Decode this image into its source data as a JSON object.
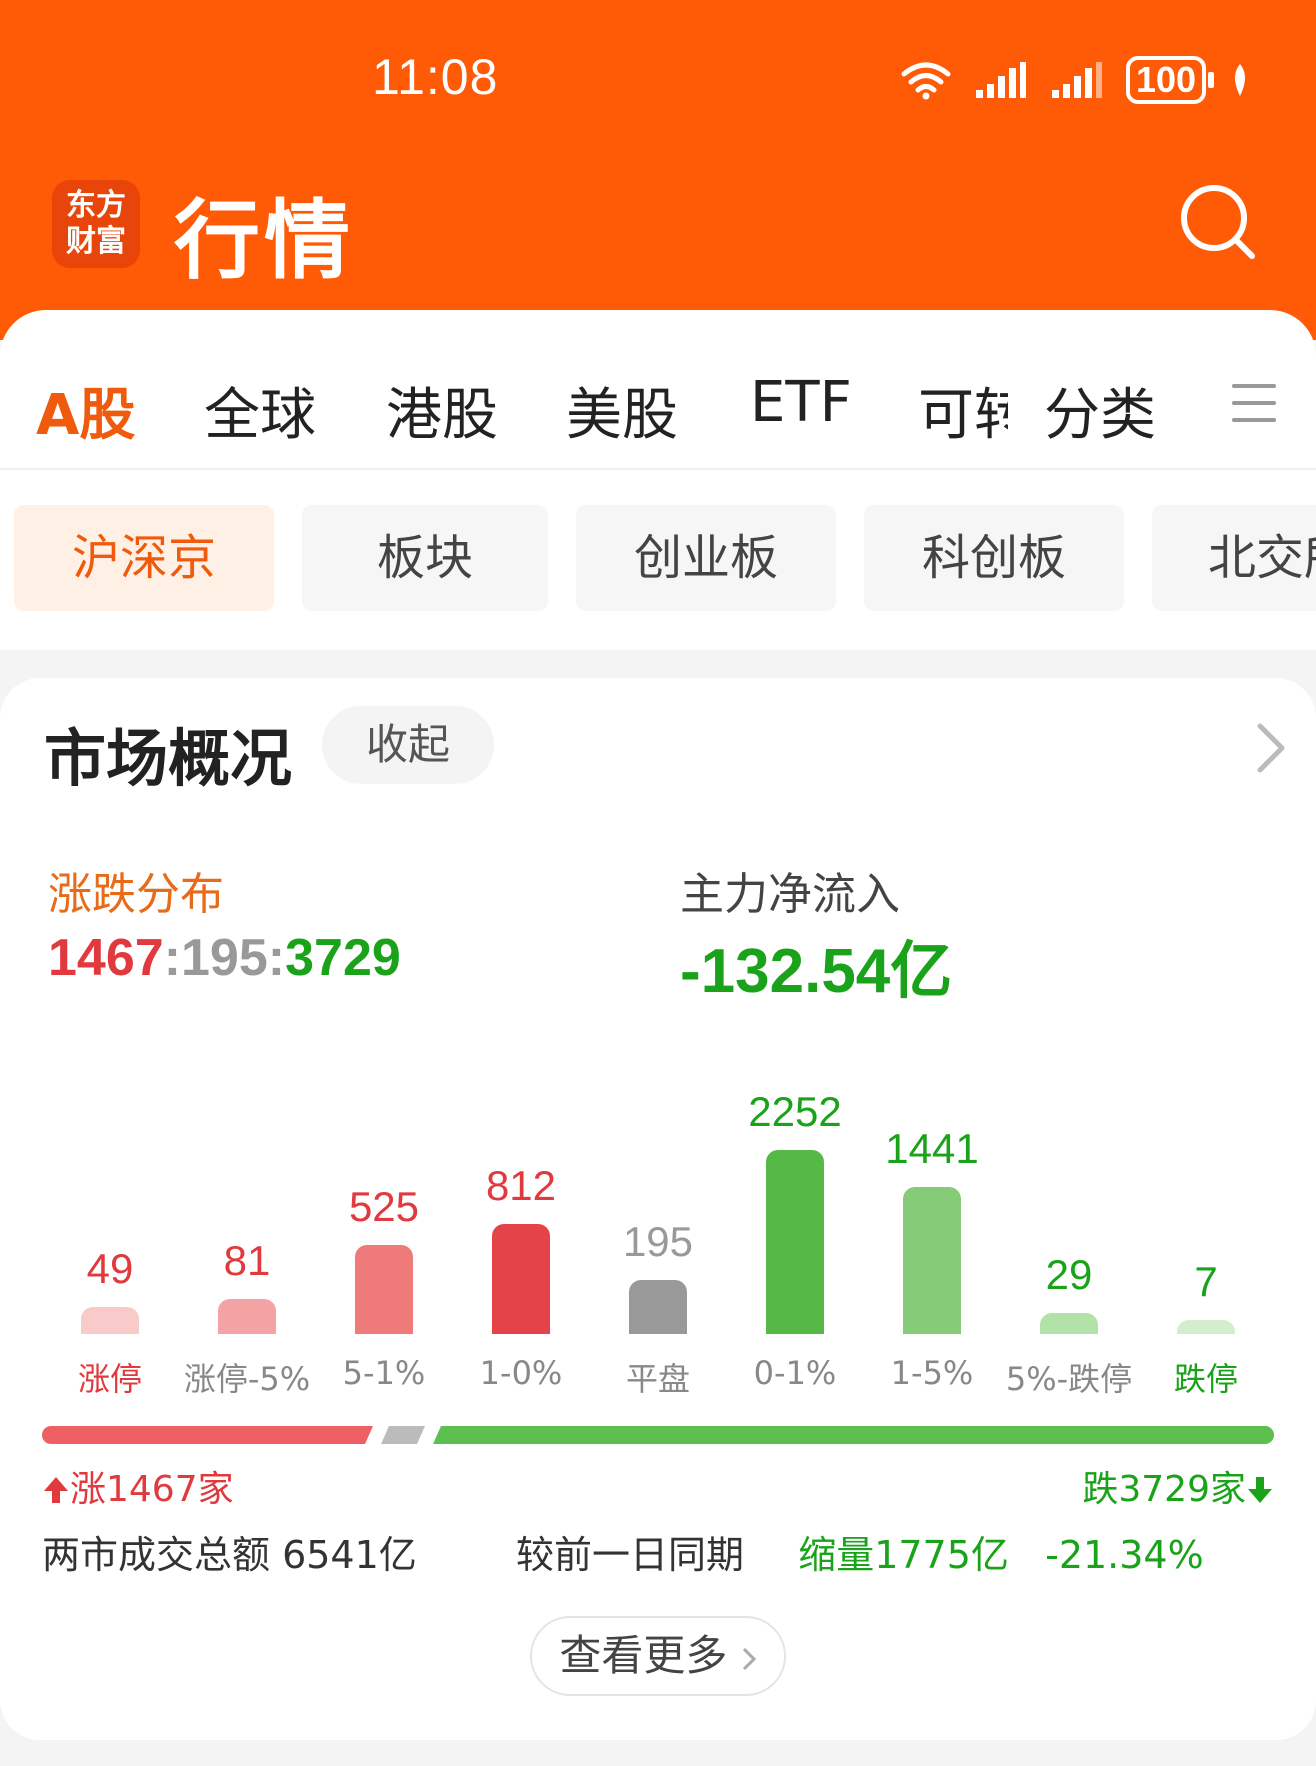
{
  "status_bar": {
    "time": "11:08",
    "battery": "100",
    "icons": [
      "wifi-icon",
      "signal-icon",
      "signal-icon",
      "battery-icon",
      "leaf-icon"
    ]
  },
  "app": {
    "logo_line1": "东方",
    "logo_line2": "财富",
    "title": "行情"
  },
  "main_tabs": [
    {
      "label": "A股",
      "active": true
    },
    {
      "label": "全球"
    },
    {
      "label": "港股"
    },
    {
      "label": "美股"
    },
    {
      "label": "ETF"
    },
    {
      "label": "可转"
    },
    {
      "label": "分类"
    }
  ],
  "sub_tabs": [
    {
      "label": "沪深京",
      "active": true
    },
    {
      "label": "板块"
    },
    {
      "label": "创业板"
    },
    {
      "label": "科创板"
    },
    {
      "label": "北交所"
    }
  ],
  "market_overview": {
    "title": "市场概况",
    "collapse_label": "收起",
    "distribution_label": "涨跌分布",
    "ratio": {
      "up": "1467",
      "sep1": ":",
      "flat": "195",
      "sep2": ":",
      "down": "3729"
    },
    "net_inflow_label": "主力净流入",
    "net_inflow_value": "-132.54亿",
    "up_count_text": "涨1467家",
    "down_count_text": "跌3729家",
    "turnover_text": "两市成交总额 6541亿",
    "compare_label": "较前一日同期",
    "compare_change": "缩量1775亿",
    "compare_pct": "-21.34%",
    "more_label": "查看更多"
  },
  "chart_data": {
    "type": "bar",
    "categories": [
      "涨停",
      "涨停-5%",
      "5-1%",
      "1-0%",
      "平盘",
      "0-1%",
      "1-5%",
      "5%-跌停",
      "跌停"
    ],
    "values": [
      49,
      81,
      525,
      812,
      195,
      2252,
      1441,
      29,
      7
    ],
    "value_labels": [
      "49",
      "81",
      "525",
      "812",
      "195",
      "2252",
      "1441",
      "29",
      "7"
    ],
    "bar_colors": [
      "#f9caca",
      "#f3a3a3",
      "#ee7a7a",
      "#e5434a",
      "#999999",
      "#56b946",
      "#86cc78",
      "#b3e2a8",
      "#d4eecd"
    ],
    "label_colors": [
      "#e0393e",
      "#888888",
      "#888888",
      "#888888",
      "#888888",
      "#888888",
      "#888888",
      "#888888",
      "#1aa31a"
    ],
    "value_colors": [
      "#e0393e",
      "#e0393e",
      "#e0393e",
      "#e0393e",
      "#999999",
      "#1aa31a",
      "#1aa31a",
      "#1aa31a",
      "#1aa31a"
    ],
    "ylim": [
      0,
      2252
    ],
    "title": "",
    "xlabel": "",
    "ylabel": ""
  },
  "ratio_bar": {
    "up": 1467,
    "flat": 195,
    "down": 3729,
    "up_color": "#ee6064",
    "flat_color": "#bbbbbb",
    "down_color": "#5cbf50"
  },
  "colors": {
    "brand": "#ff5a06",
    "accent": "#f05a0c",
    "up": "#e0393e",
    "down": "#1aa31a"
  }
}
